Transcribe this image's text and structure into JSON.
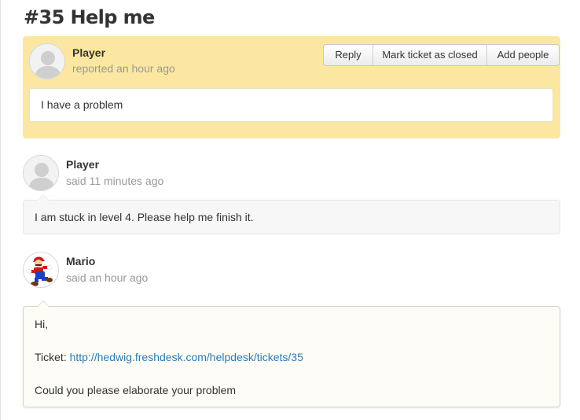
{
  "ticket": {
    "title": "#35 Help me",
    "requester": "Player",
    "reported": "reported an hour ago",
    "description": "I have a problem",
    "actions": {
      "reply": "Reply",
      "close": "Mark ticket as closed",
      "add_people": "Add people"
    }
  },
  "notes": [
    {
      "author": "Player",
      "time": "said 11 minutes ago",
      "avatar": "default-avatar-icon",
      "body": "I am stuck in level 4. Please help me finish it."
    },
    {
      "author": "Mario",
      "time": "said an hour ago",
      "avatar": "mario-avatar",
      "greeting": "Hi,",
      "ticket_label": "Ticket: ",
      "ticket_link": "http://hedwig.freshdesk.com/helpdesk/tickets/35",
      "closing": "Could you please elaborate your problem"
    }
  ],
  "colors": {
    "ticket_bg": "#fbe7a1",
    "link": "#2a7ab5",
    "meta_text": "#999999"
  }
}
